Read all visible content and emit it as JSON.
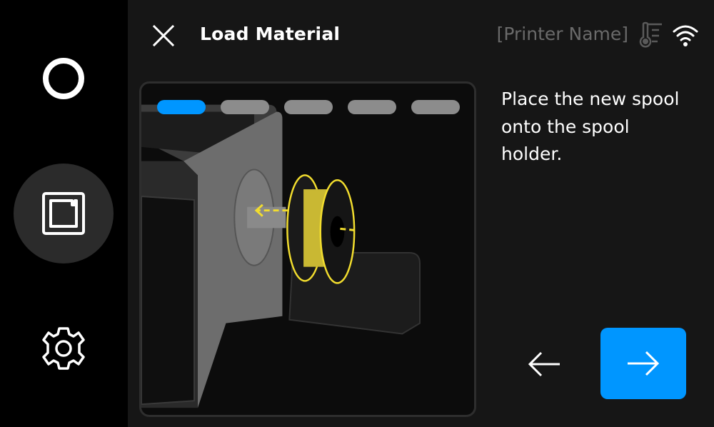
{
  "sidebar": {
    "items": [
      {
        "name": "home",
        "icon": "circle-icon",
        "active": false
      },
      {
        "name": "material",
        "icon": "spool-box-icon",
        "active": true
      },
      {
        "name": "settings",
        "icon": "gear-icon",
        "active": false
      }
    ]
  },
  "header": {
    "title": "Load Material",
    "close_icon": "close-icon",
    "printer_name": "[Printer Name]",
    "status_icons": [
      "thermometer-icon",
      "wifi-icon"
    ]
  },
  "wizard": {
    "total_steps": 5,
    "current_step": 1,
    "illustration": "printer-spool-holder-illustration",
    "instruction": "Place the new spool onto the spool holder."
  },
  "navigation": {
    "back_icon": "arrow-left-icon",
    "next_icon": "arrow-right-icon"
  },
  "colors": {
    "accent": "#0096ff",
    "highlight": "#f2dd2e",
    "background": "#161616",
    "sidebar": "#000000",
    "muted_text": "#6a6a6a",
    "step_inactive": "#8c8c8c"
  }
}
